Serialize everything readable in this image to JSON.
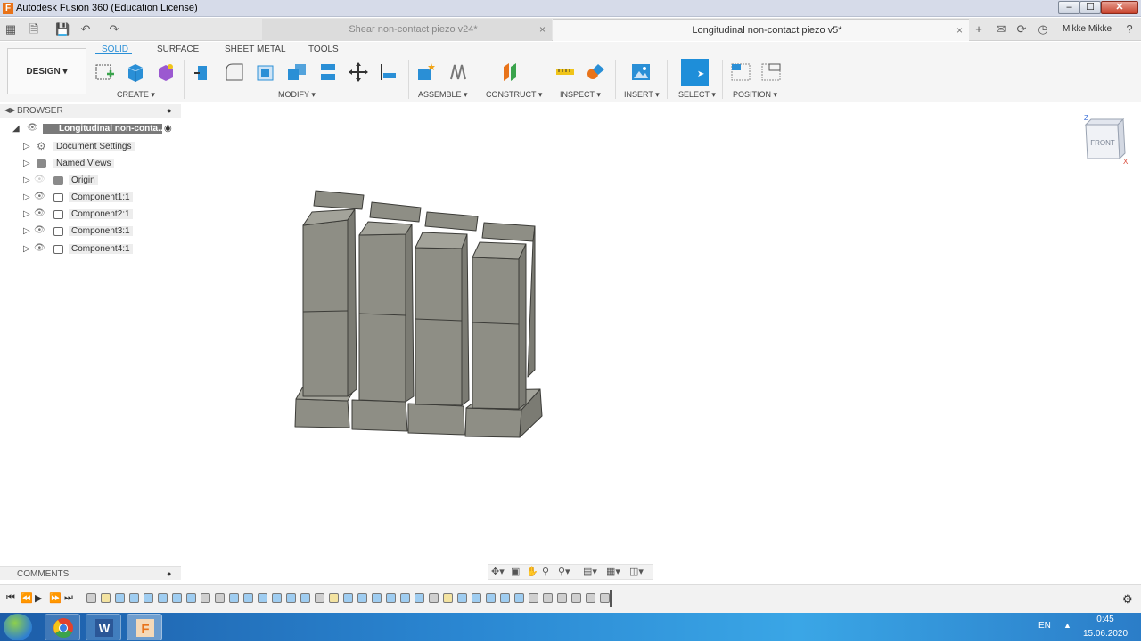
{
  "window": {
    "title": "Autodesk Fusion 360 (Education License)",
    "logo": "F",
    "min": "–",
    "max": "☐",
    "close": "✕"
  },
  "tabs": [
    {
      "label": "Shear non-contact piezo v24*",
      "active": false,
      "close": "×"
    },
    {
      "label": "Longitudinal non-contact piezo v5*",
      "active": true,
      "close": "×"
    }
  ],
  "user": "Mikke Mikke",
  "workspace": {
    "label": "DESIGN ▾"
  },
  "ribbon_tabs": [
    "SOLID",
    "SURFACE",
    "SHEET METAL",
    "TOOLS"
  ],
  "toolbar_groups": [
    {
      "label": "CREATE ▾"
    },
    {
      "label": "MODIFY ▾"
    },
    {
      "label": "ASSEMBLE ▾"
    },
    {
      "label": "CONSTRUCT ▾"
    },
    {
      "label": "INSPECT ▾"
    },
    {
      "label": "INSERT ▾"
    },
    {
      "label": "SELECT ▾"
    },
    {
      "label": "POSITION ▾"
    }
  ],
  "browser": {
    "header": "BROWSER",
    "root": "Longitudinal non-conta...",
    "items": [
      {
        "label": "Document Settings"
      },
      {
        "label": "Named Views"
      },
      {
        "label": "Origin"
      },
      {
        "label": "Component1:1"
      },
      {
        "label": "Component2:1"
      },
      {
        "label": "Component3:1"
      },
      {
        "label": "Component4:1"
      }
    ]
  },
  "comments": {
    "header": "COMMENTS"
  },
  "viewcube": {
    "face": "FRONT",
    "axis_z": "Z",
    "axis_x": "X"
  },
  "taskbar": {
    "lang": "EN",
    "time": "0:45",
    "date": "15.06.2020"
  },
  "colors": {
    "accent": "#2a8fd6",
    "select_active": "#1e8ed9",
    "model_face": "#8e8e85",
    "model_top": "#a3a39a",
    "model_side": "#7b7b73"
  }
}
